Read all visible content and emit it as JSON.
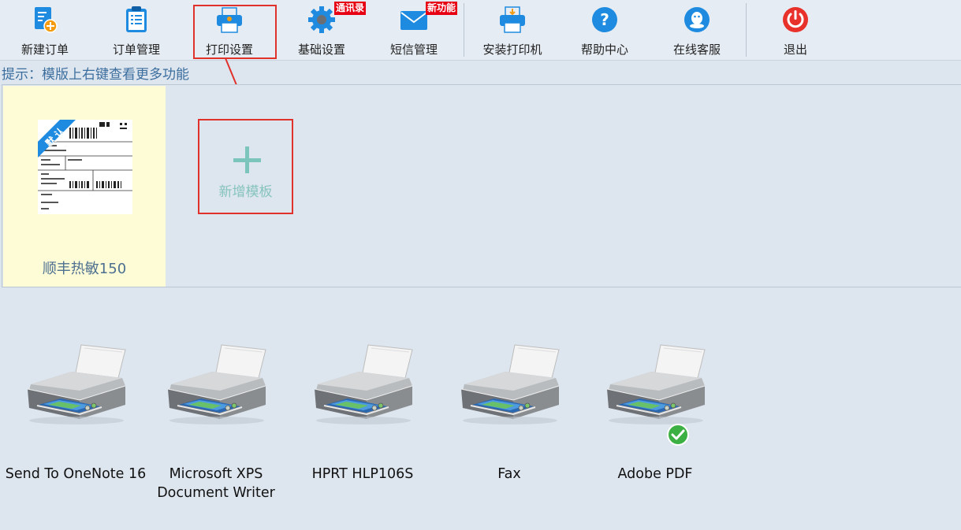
{
  "toolbar": {
    "items": [
      {
        "label": "新建订单",
        "icon": "new-order-icon"
      },
      {
        "label": "订单管理",
        "icon": "clipboard-icon"
      },
      {
        "label": "打印设置",
        "icon": "printer-settings-icon"
      },
      {
        "label": "基础设置",
        "icon": "gear-icon",
        "badge": "通讯录"
      },
      {
        "label": "短信管理",
        "icon": "envelope-icon",
        "badge": "新功能"
      },
      {
        "label": "安装打印机",
        "icon": "install-printer-icon"
      },
      {
        "label": "帮助中心",
        "icon": "help-icon"
      },
      {
        "label": "在线客服",
        "icon": "qq-icon"
      },
      {
        "label": "退出",
        "icon": "power-icon"
      }
    ]
  },
  "hint": "提示：模版上右键查看更多功能",
  "templates": {
    "items": [
      {
        "name": "顺丰热敏150",
        "ribbon": "默认",
        "selected": true
      }
    ],
    "add_label": "新增模板"
  },
  "printers": [
    {
      "name_line1": "Send To OneNote 16",
      "name_line2": "",
      "default": false
    },
    {
      "name_line1": "Microsoft XPS",
      "name_line2": "Document Writer",
      "default": false
    },
    {
      "name_line1": "HPRT HLP106S",
      "name_line2": "",
      "default": false
    },
    {
      "name_line1": "Fax",
      "name_line2": "",
      "default": false
    },
    {
      "name_line1": "Adobe PDF",
      "name_line2": "",
      "default": true
    }
  ],
  "colors": {
    "accent_blue": "#1e8be0",
    "badge_red": "#e60012",
    "highlight_red": "#e0312b",
    "selected_template_bg": "#fdfcd6",
    "check_green": "#3cb043"
  }
}
